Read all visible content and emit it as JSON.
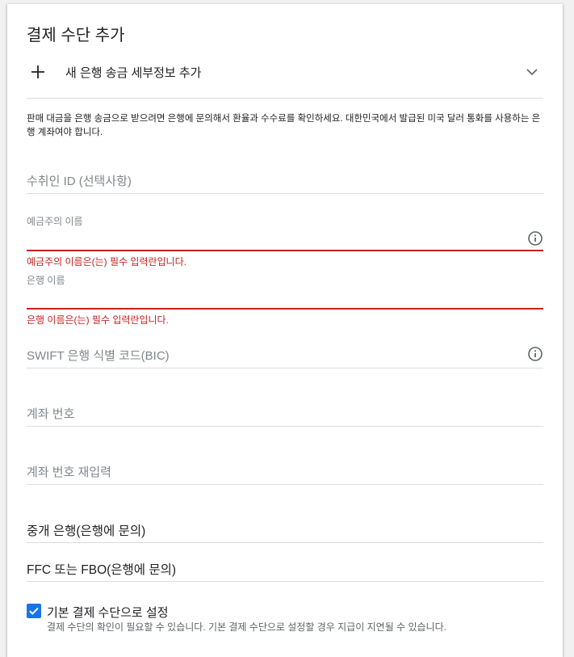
{
  "title": "결제 수단 추가",
  "add_bank": {
    "label": "새 은행 송금 세부정보 추가",
    "icon": "plus-icon",
    "expand_icon": "chevron-down-icon"
  },
  "info": "판매 대금을 은행 송금으로 받으려면 은행에 문의해서 환율과 수수료를 확인하세요. 대한민국에서 발급된 미국 달러 통화를 사용하는 은행 계좌여야 합니다.",
  "fields": {
    "payee_id": {
      "placeholder": "수취인 ID (선택사항)"
    },
    "holder_name": {
      "label": "예금주의 이름",
      "error": "예금주의 이름은(는) 필수 입력란입니다.",
      "icon": "info-icon"
    },
    "bank_name": {
      "label": "은행 이름",
      "error": "은행 이름은(는) 필수 입력란입니다."
    },
    "swift": {
      "placeholder": "SWIFT 은행 식별 코드(BIC)",
      "icon": "info-icon"
    },
    "account_number": {
      "placeholder": "계좌 번호"
    },
    "account_number_confirm": {
      "placeholder": "계좌 번호 재입력"
    },
    "intermediary_bank": {
      "label": "중개 은행(은행에 문의)"
    },
    "ffc_fbo": {
      "label": "FFC 또는 FBO(은행에 문의)"
    }
  },
  "default_payment": {
    "checked": true,
    "label": "기본 결제 수단으로 설정",
    "note": "결제 수단의 확인이 필요할 수 있습니다. 기본 결제 수단으로 설정할 경우 지급이 지연될 수 있습니다."
  },
  "colors": {
    "accent": "#1a73e8",
    "error": "#c5221f",
    "divider": "#dadce0",
    "muted": "#80868b"
  }
}
